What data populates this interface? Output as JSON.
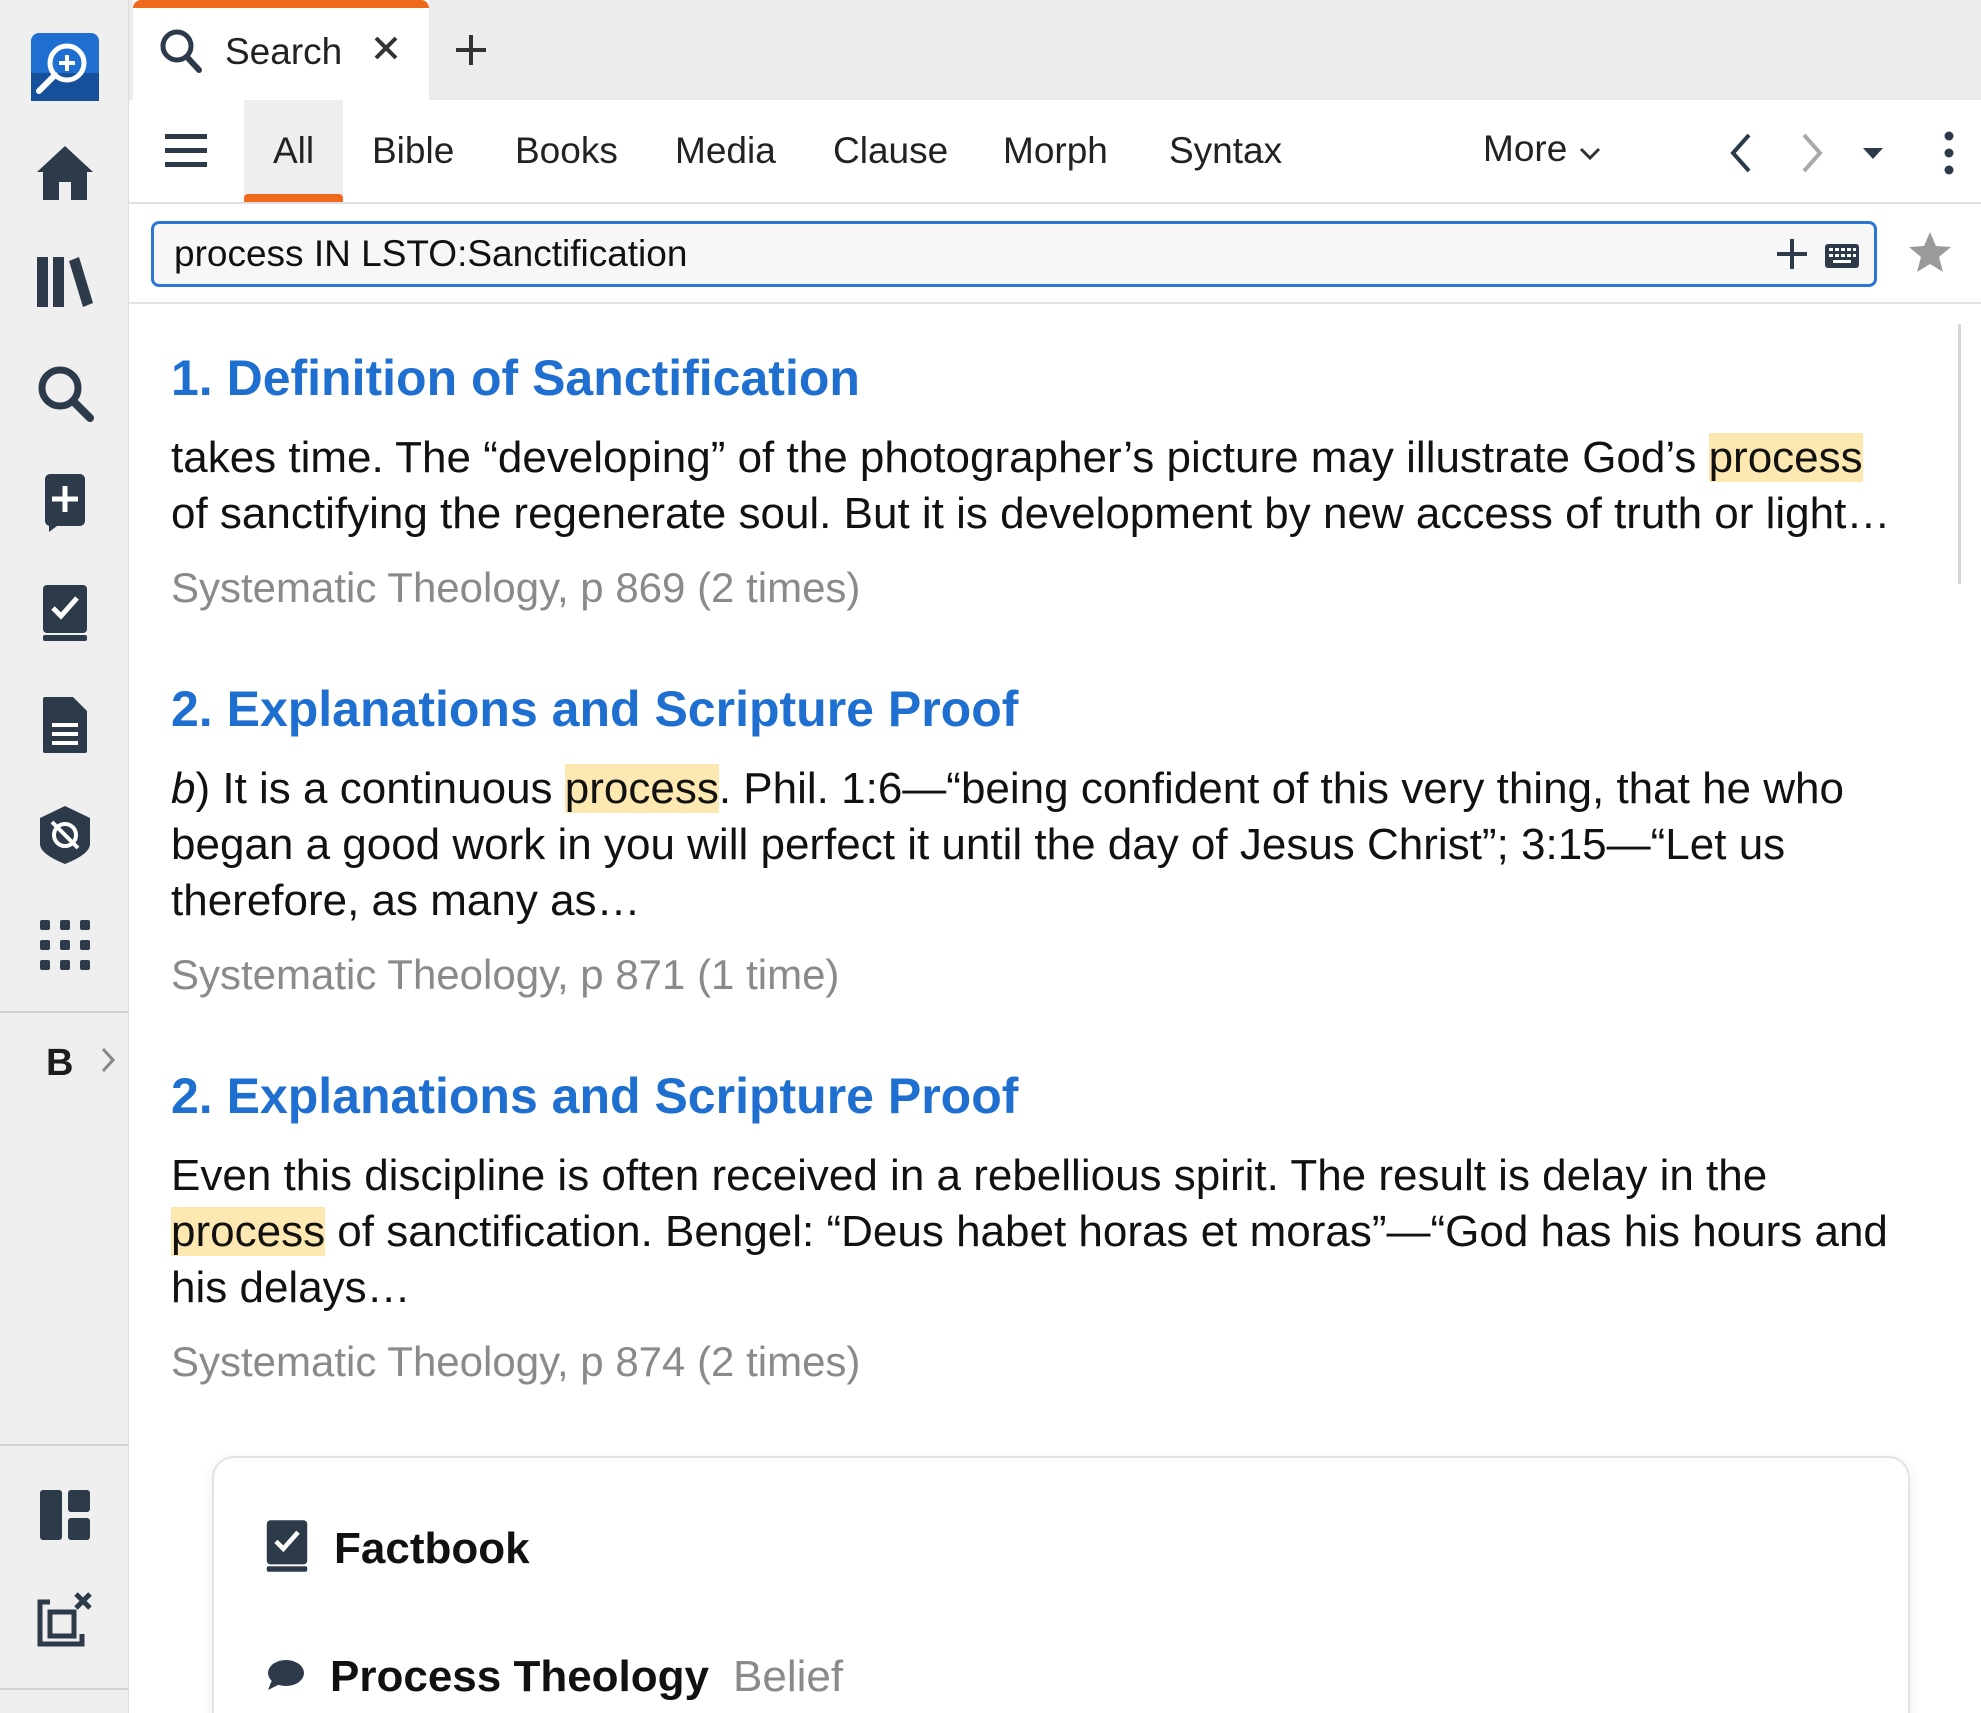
{
  "tab": {
    "label": "Search"
  },
  "filters": {
    "tabs": [
      "All",
      "Bible",
      "Books",
      "Media",
      "Clause",
      "Morph",
      "Syntax"
    ],
    "active": "All",
    "more_label": "More"
  },
  "search": {
    "query": "process IN LSTO:Sanctification"
  },
  "rail": {
    "b_label": "B"
  },
  "results": [
    {
      "title": "1. Definition of Sanctification",
      "before": "takes time. The “developing” of the photographer’s picture may illustrate God’s ",
      "highlight": "process",
      "after": " of sanctifying the regenerate soul. But it is development by new access of truth or light…",
      "source": "Systematic Theology, p 869 (2 times)"
    },
    {
      "title": "2. Explanations and Scripture Proof",
      "italic_prefix": "b",
      "before": ") It is a continuous ",
      "highlight": "process",
      "after": ". Phil. 1:6—“being confident of this very thing, that he who began a good work in you will perfect it until the day of Jesus Christ”; 3:15—“Let us therefore, as many as…",
      "source": "Systematic Theology, p 871 (1 time)"
    },
    {
      "title": "2. Explanations and Scripture Proof",
      "before": "Even this discipline is often received in a rebellious spirit. The result is delay in the ",
      "highlight": "process",
      "after": " of sanctification. Bengel: “Deus habet horas et moras”—“God has his hours and his delays…",
      "source": "Systematic Theology, p 874 (2 times)"
    }
  ],
  "card": {
    "factbook_label": "Factbook",
    "entry_title": "Process Theology",
    "entry_type": "Belief"
  },
  "colors": {
    "accent": "#f06a1d",
    "link": "#1f6fd0",
    "highlight": "#fde8b2",
    "rail_icon": "#2d3a4a",
    "logo": "#1f6fd0"
  }
}
